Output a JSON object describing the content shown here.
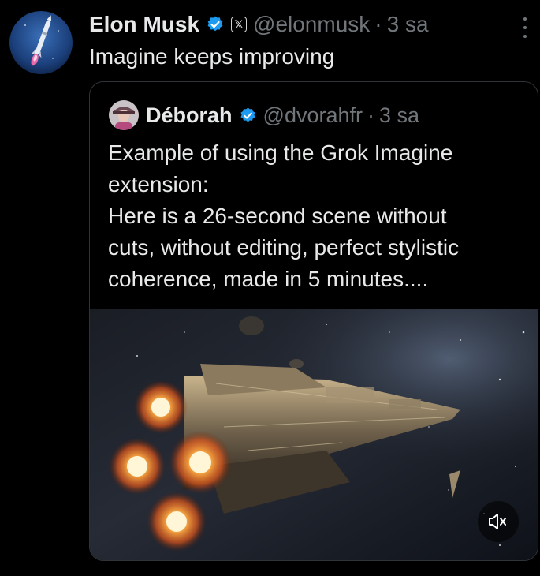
{
  "tweet": {
    "author_name": "Elon Musk",
    "handle": "@elonmusk",
    "separator": "·",
    "time": "3 sa",
    "text": "Imagine keeps improving",
    "avatar_icon": "rocket-avatar",
    "verified_color": "#1d9bf0"
  },
  "quote": {
    "author_name": "Déborah",
    "handle": "@dvorahfr",
    "separator": "·",
    "time": "3 sa",
    "lines": [
      "Example of using the Grok Imagine",
      "extension:",
      "Here is a 26-second scene without",
      "cuts, without editing, perfect stylistic",
      "coherence, made in 5 minutes...."
    ],
    "media": {
      "type": "video",
      "description_icon": "spaceship-video",
      "mute_icon": "speaker-muted-icon"
    }
  },
  "colors": {
    "background": "#000000",
    "text": "#e7e9ea",
    "secondary": "#71767b",
    "border": "#2f3336",
    "verified": "#1d9bf0"
  }
}
